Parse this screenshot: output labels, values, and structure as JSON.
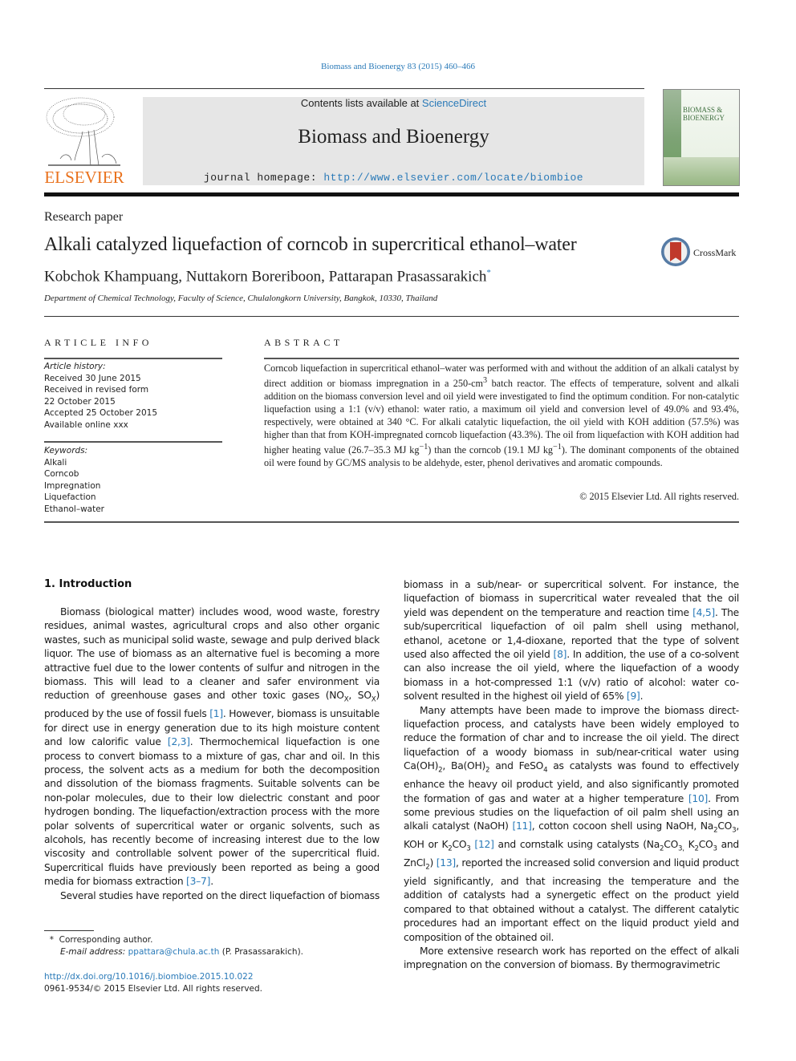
{
  "header": {
    "journal_ref": "Biomass and Bioenergy 83 (2015) 460–466",
    "contents_prefix": "Contents lists available at ",
    "contents_link": "ScienceDirect",
    "journal_title": "Biomass and Bioenergy",
    "homepage_prefix": "journal homepage: ",
    "homepage_url": "http://www.elsevier.com/locate/biombioe",
    "publisher_logo": "ELSEVIER",
    "cover_title": "BIOMASS & BIOENERGY"
  },
  "article": {
    "type": "Research paper",
    "title": "Alkali catalyzed liquefaction of corncob in supercritical ethanol–water",
    "crossmark_label": "CrossMark",
    "authors": "Kobchok Khampuang, Nuttakorn Boreriboon, Pattarapan Prasassarakich",
    "author_mark": "*",
    "affiliation": "Department of Chemical Technology, Faculty of Science, Chulalongkorn University, Bangkok, 10330, Thailand"
  },
  "article_info": {
    "heading": "ARTICLE INFO",
    "history_label": "Article history:",
    "history": [
      "Received 30 June 2015",
      "Received in revised form",
      "22 October 2015",
      "Accepted 25 October 2015",
      "Available online xxx"
    ],
    "keywords_label": "Keywords:",
    "keywords": [
      "Alkali",
      "Corncob",
      "Impregnation",
      "Liquefaction",
      "Ethanol–water"
    ]
  },
  "abstract": {
    "heading": "ABSTRACT",
    "text_1": "Corncob liquefaction in supercritical ethanol–water was performed with and without the addition of an alkali catalyst by direct addition or biomass impregnation in a 250-cm",
    "text_1_sup": "3",
    "text_2": " batch reactor. The effects of temperature, solvent and alkali addition on the biomass conversion level and oil yield were investigated to find the optimum condition. For non-catalytic liquefaction using a 1:1 (v/v) ethanol: water ratio, a maximum oil yield and conversion level of 49.0% and 93.4%, respectively, were obtained at 340 °C. For alkali catalytic liquefaction, the oil yield with KOH addition (57.5%) was higher than that from KOH-impregnated corncob liquefaction (43.3%). The oil from liquefaction with KOH addition had higher heating value (26.7–35.3 MJ kg",
    "text_2_sup": "−1",
    "text_3": ") than the corncob (19.1 MJ kg",
    "text_3_sup": "−1",
    "text_4": "). The dominant components of the obtained oil were found by GC/MS analysis to be aldehyde, ester, phenol derivatives and aromatic compounds.",
    "copyright": "© 2015 Elsevier Ltd. All rights reserved."
  },
  "intro": {
    "heading": "1.  Introduction",
    "p1_a": "Biomass (biological matter) includes wood, wood waste, forestry residues, animal wastes, agricultural crops and also other organic wastes, such as municipal solid waste, sewage and pulp derived black liquor. The use of biomass as an alternative fuel is becoming a more attractive fuel due to the lower contents of sulfur and nitrogen in the biomass. This will lead to a cleaner and safer environment via reduction of greenhouse gases and other toxic gases (NO",
    "p1_sub1": "X",
    "p1_b": ", SO",
    "p1_sub2": "X",
    "p1_c": ") produced by the use of fossil fuels ",
    "ref_1": "[1]",
    "p1_d": ". However, biomass is unsuitable for direct use in energy generation due to its high moisture content and low calorific value ",
    "ref_2": "[2,3]",
    "p1_e": ". Thermochemical liquefaction is one process to convert biomass to a mixture of gas, char and oil. In this process, the solvent acts as a medium for both the decomposition and dissolution of the biomass fragments. Suitable solvents can be non-polar molecules, due to their low dielectric constant and poor hydrogen bonding. The liquefaction/extraction process with the more polar solvents of supercritical water or organic solvents, such as alcohols, has recently become of increasing interest due to the low viscosity and controllable solvent power of the supercritical fluid. Supercritical fluids have previously been reported as being a good media for biomass extraction ",
    "ref_3": "[3–7]",
    "p1_f": ".",
    "p2_a": "Several studies have reported on the direct liquefaction of biomass in a sub/near- or supercritical solvent. For instance, the liquefaction of biomass in supercritical water revealed that the oil yield was dependent on the temperature and reaction time ",
    "ref_4": "[4,5]",
    "p2_b": ". The sub/supercritical liquefaction of oil palm shell using methanol, ethanol, acetone or 1,4-dioxane, reported that the type of solvent used also affected the oil yield ",
    "ref_5": "[8]",
    "p2_c": ". In addition, the use of a co-solvent can also increase the oil yield, where the liquefaction of a woody biomass in a hot-compressed 1:1 (v/v) ratio of alcohol: water co-solvent resulted in the highest oil yield of 65% ",
    "ref_6": "[9]",
    "p2_d": ".",
    "p3_a": "Many attempts have been made to improve the biomass direct-liquefaction process, and catalysts have been widely employed to reduce the formation of char and to increase the oil yield. The direct liquefaction of a woody biomass in sub/near-critical water using Ca(OH)",
    "p3_sub1": "2",
    "p3_b": ", Ba(OH)",
    "p3_sub2": "2",
    "p3_c": " and FeSO",
    "p3_sub3": "4",
    "p3_d": " as catalysts was found to effectively enhance the heavy oil product yield, and also significantly promoted the formation of gas and water at a higher temperature ",
    "ref_7": "[10]",
    "p3_e": ". From some previous studies on the liquefaction of oil palm shell using an alkali catalyst (NaOH) ",
    "ref_8": "[11]",
    "p3_f": ", cotton cocoon shell using NaOH, Na",
    "p3_sub4": "2",
    "p3_g": "CO",
    "p3_sub5": "3",
    "p3_h": ", KOH or K",
    "p3_sub6": "2",
    "p3_i": "CO",
    "p3_sub7": "3",
    "p3_j": " ",
    "ref_9": "[12]",
    "p3_k": " and cornstalk using catalysts (Na",
    "p3_sub8": "2",
    "p3_l": "CO",
    "p3_sub9": "3,",
    "p3_m": " K",
    "p3_sub10": "2",
    "p3_n": "CO",
    "p3_sub11": "3",
    "p3_o": " and ZnCl",
    "p3_sub12": "2",
    "p3_p": ") ",
    "ref_10": "[13]",
    "p3_q": ", reported the increased solid conversion and liquid product yield significantly, and that increasing the temperature and the addition of catalysts had a synergetic effect on the product yield compared to that obtained without a catalyst. The different catalytic procedures had an important effect on the liquid product yield and composition of the obtained oil.",
    "p4": "More extensive research work has reported on the effect of alkali impregnation on the conversion of biomass. By thermogravimetric"
  },
  "footnote": {
    "mark": "*",
    "corresponding": "Corresponding author.",
    "email_label": "E-mail address:",
    "email": "ppattara@chula.ac.th",
    "email_owner": " (P. Prasassarakich)."
  },
  "doi": {
    "url": "http://dx.doi.org/10.1016/j.biombioe.2015.10.022",
    "issn": "0961-9534/© 2015 Elsevier Ltd. All rights reserved."
  }
}
